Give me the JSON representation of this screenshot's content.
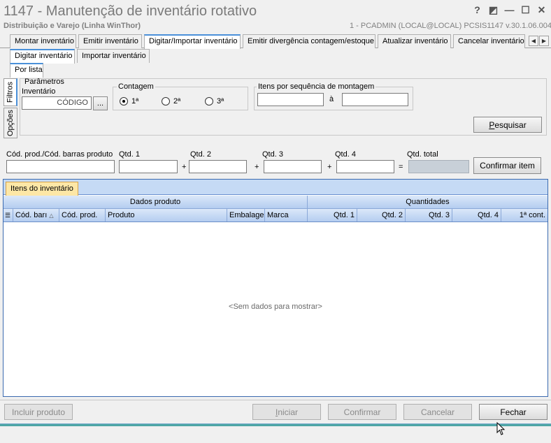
{
  "window": {
    "title": "1147 - Manutenção de inventário rotativo",
    "subtitle": "Distribuição e Varejo (Linha WinThor)",
    "userinfo": "1 - PCADMIN (LOCAL@LOCAL)   PCSIS1147  v.30.1.06.004",
    "btn_help": "?",
    "btn_restore": "◩",
    "btn_min": "—",
    "btn_max": "☐",
    "btn_close": "✕"
  },
  "main_tabs": [
    "Montar inventário",
    "Emitir inventário",
    "Digitar/Importar inventário",
    "Emitir divergência contagem/estoque",
    "Atualizar inventário",
    "Cancelar inventário"
  ],
  "sub_tabs": [
    "Digitar inventário",
    "Importar inventário"
  ],
  "sub_sub_tabs": [
    "Por lista"
  ],
  "side_tabs": [
    "Filtros",
    "Opções"
  ],
  "filters": {
    "params_label": "Parâmetros",
    "inventario_label": "Inventário",
    "inventario_placeholder": "CÓDIGO",
    "browse_label": "...",
    "contagem_label": "Contagem",
    "contagem_options": [
      "1ª",
      "2ª",
      "3ª"
    ],
    "contagem_selected": "1ª",
    "itens_seq_label": "Itens por sequência de montagem",
    "itens_seq_sep": "à",
    "pesquisar_label": "Pesquisar"
  },
  "entry": {
    "cod_label": "Cód. prod./Cód. barras produto",
    "qtd1_label": "Qtd. 1",
    "qtd2_label": "Qtd. 2",
    "qtd3_label": "Qtd. 3",
    "qtd4_label": "Qtd. 4",
    "qtd_total_label": "Qtd. total",
    "plus": "+",
    "equals": "=",
    "confirm_label": "Confirmar item"
  },
  "grid": {
    "tab_label": "Itens do inventário",
    "band_produto": "Dados produto",
    "band_quantidades": "Quantidades",
    "columns": [
      "Cód. barı",
      "Cód. prod.",
      "Produto",
      "Embalager",
      "Marca",
      "Qtd. 1",
      "Qtd. 2",
      "Qtd. 3",
      "Qtd. 4",
      "1ª cont."
    ],
    "empty_text": "<Sem dados para mostrar>"
  },
  "footer": {
    "incluir_label": "Incluir produto",
    "iniciar_label": "Iniciar",
    "confirmar_label": "Confirmar",
    "cancelar_label": "Cancelar",
    "fechar_label": "Fechar"
  }
}
